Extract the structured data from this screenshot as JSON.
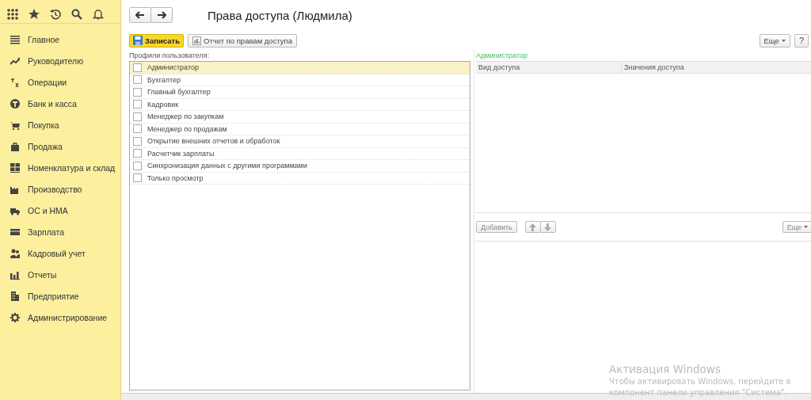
{
  "sidebar": {
    "items": [
      {
        "label": "Главное"
      },
      {
        "label": "Руководителю"
      },
      {
        "label": "Операции"
      },
      {
        "label": "Банк и касса"
      },
      {
        "label": "Покупка"
      },
      {
        "label": "Продажа"
      },
      {
        "label": "Номенклатура и склад"
      },
      {
        "label": "Производство"
      },
      {
        "label": "ОС и НМА"
      },
      {
        "label": "Зарплата"
      },
      {
        "label": "Кадровый учет"
      },
      {
        "label": "Отчеты"
      },
      {
        "label": "Предприятие"
      },
      {
        "label": "Администрирование"
      }
    ]
  },
  "window": {
    "title": "Права доступа (Людмила)"
  },
  "toolbar": {
    "save": "Записать",
    "report": "Отчет по правам доступа",
    "more": "Еще",
    "help": "?"
  },
  "profiles": {
    "label": "Профили пользователя:",
    "rows": [
      {
        "name": "Администратор",
        "checked": false,
        "selected": true
      },
      {
        "name": "Бухгалтер",
        "checked": false,
        "selected": false
      },
      {
        "name": "Главный бухгалтер",
        "checked": false,
        "selected": false
      },
      {
        "name": "Кадровик",
        "checked": false,
        "selected": false
      },
      {
        "name": "Менеджер по закупкам",
        "checked": false,
        "selected": false
      },
      {
        "name": "Менеджер по продажам",
        "checked": false,
        "selected": false
      },
      {
        "name": "Открытие внешних отчетов и обработок",
        "checked": false,
        "selected": false
      },
      {
        "name": "Расчетчик зарплаты",
        "checked": false,
        "selected": false
      },
      {
        "name": "Синхронизация данных с другими программами",
        "checked": false,
        "selected": false
      },
      {
        "name": "Только просмотр",
        "checked": false,
        "selected": false
      }
    ]
  },
  "access": {
    "label": "Администратор",
    "columns": [
      "Вид доступа",
      "Значения доступа"
    ],
    "add": "Добавить",
    "more": "Еще"
  },
  "activation": {
    "title": "Активация Windows",
    "text": "Чтобы активировать Windows, перейдите в",
    "text_2": "компонент панели управления \"Система\"."
  }
}
